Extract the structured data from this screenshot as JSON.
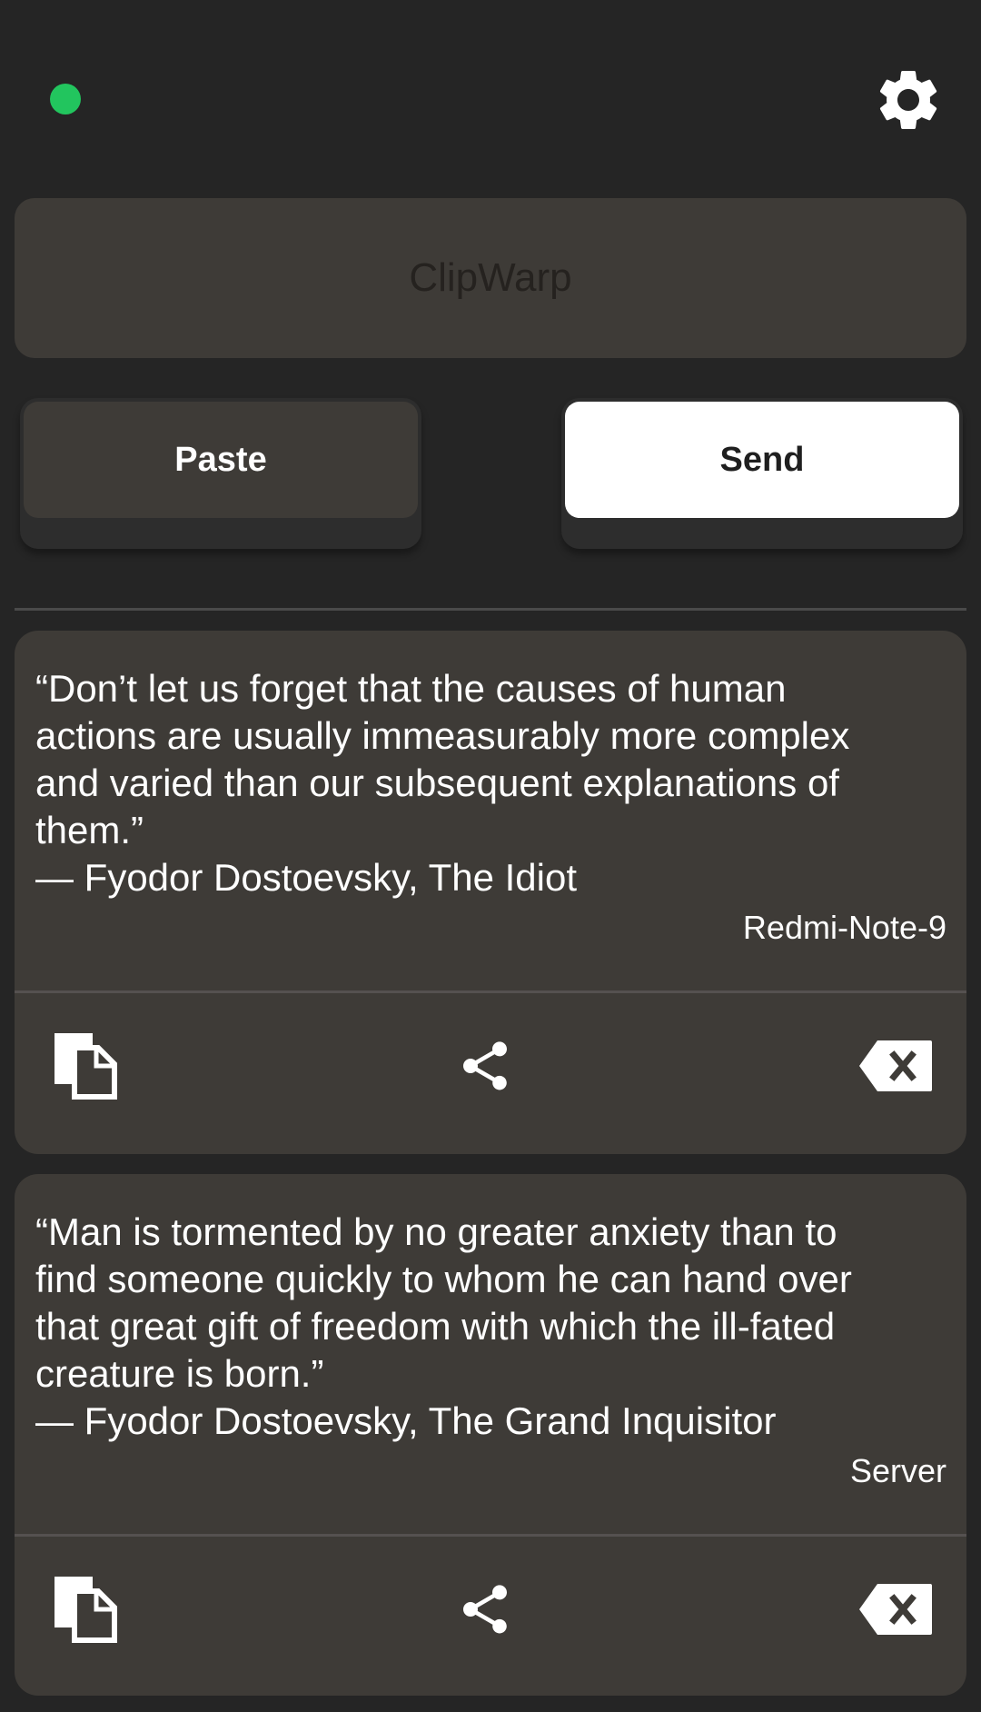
{
  "header": {
    "connection_status_color": "#22c55e",
    "settings_icon": "gear-icon"
  },
  "input": {
    "placeholder": "ClipWarp",
    "value": ""
  },
  "actions": {
    "paste_label": "Paste",
    "send_label": "Send"
  },
  "clips": [
    {
      "text": "“Don’t let us forget that the causes of human\nactions are usually immeasurably more complex\nand varied than our subsequent explanations of\nthem.”\n— Fyodor Dostoevsky, The Idiot",
      "source": "Redmi-Note-9",
      "icons": [
        "copy-icon",
        "share-icon",
        "backspace-delete-icon"
      ]
    },
    {
      "text": "“Man is tormented by no greater anxiety than to\nfind someone quickly to whom he can hand over\nthat great gift of freedom with which the ill-fated\ncreature is born.”\n— Fyodor Dostoevsky, The Grand Inquisitor",
      "source": "Server",
      "icons": [
        "copy-icon",
        "share-icon",
        "backspace-delete-icon"
      ]
    }
  ]
}
